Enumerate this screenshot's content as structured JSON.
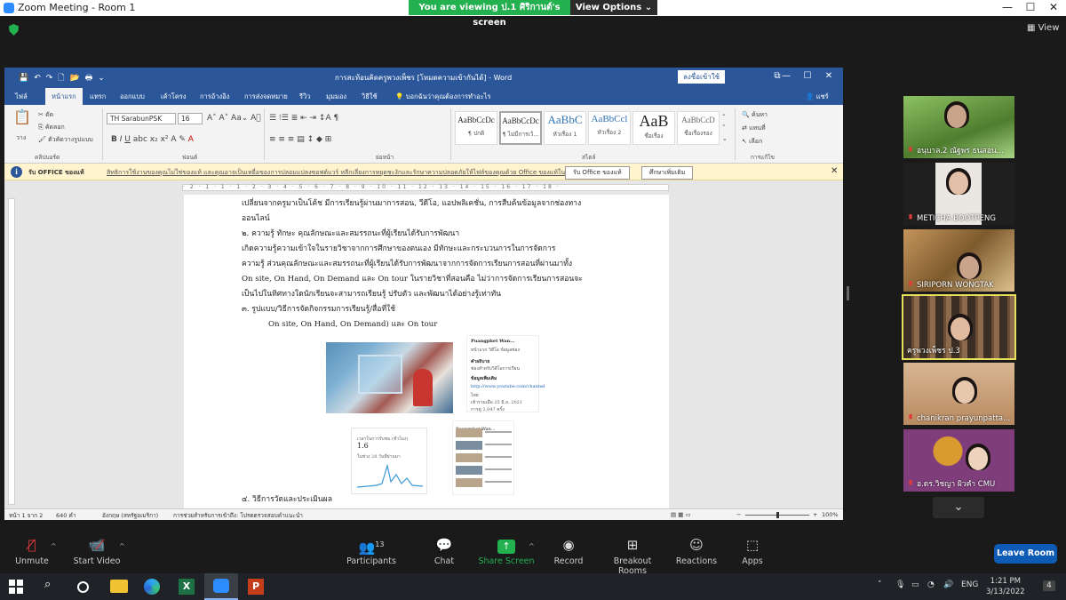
{
  "window": {
    "title": "Zoom Meeting - Room 1",
    "banner_text": "You are viewing ป.1 ศิริกานต์'s screen",
    "view_options": "View Options ⌄",
    "view_button": "View",
    "winctl": {
      "min": "—",
      "max": "☐",
      "close": "✕"
    }
  },
  "word": {
    "doc_title": "การสะท้อนคิดครูพวงเพ็ชร [โหมดความเข้ากันได้]  -  Word",
    "signin": "ลงชื่อเข้าใช้",
    "quick_access": "💾↶↷🗋📂🖶⌄",
    "winctl": {
      "restore": "⧉",
      "min": "—",
      "max": "☐",
      "close": "✕"
    },
    "tabs": [
      "ไฟล์",
      "หน้าแรก",
      "แทรก",
      "ออกแบบ",
      "เค้าโครง",
      "การอ้างอิง",
      "การส่งจดหมาย",
      "รีวิว",
      "มุมมอง",
      "วิธีใช้",
      "บอกฉันว่าคุณต้องการทำอะไร"
    ],
    "share": "แชร์",
    "ribbon": {
      "paste": "วาง",
      "cut": "ตัด",
      "copy": "คัดลอก",
      "format_painter": "ตัวคัดวางรูปแบบ",
      "font_name": "TH SarabunPSK",
      "font_size": "16",
      "find": "ค้นหา",
      "replace": "แทนที่",
      "select": "เลือก",
      "groups": [
        "คลิปบอร์ด",
        "ฟอนต์",
        "ย่อหน้า",
        "สไตล์",
        "การแก้ไข"
      ],
      "styles": [
        {
          "sample": "AaBbCcDc",
          "name": "¶ ปกติ"
        },
        {
          "sample": "AaBbCcDc",
          "name": "¶ ไม่มีการเว้..."
        },
        {
          "sample": "AaBbC",
          "name": "หัวเรื่อง 1"
        },
        {
          "sample": "AaBbCcl",
          "name": "หัวเรื่อง 2"
        },
        {
          "sample": "AaB",
          "name": "ชื่อเรื่อง"
        },
        {
          "sample": "AaBbCcD",
          "name": "ชื่อเรื่องรอง"
        }
      ]
    },
    "info_bar": {
      "label": "รับ OFFICE ของแท้",
      "message": "สิทธิการใช้งานของคุณไม่ใช่ของแท้ และคุณอาจเป็นเหยื่อของการปลอมแปลงซอฟต์แวร์ หลีกเลี่ยงการหยุดชะงักและรักษาความปลอดภัยให้ไฟล์ของคุณด้วย Office ของแท้ในวันนี้",
      "btn1": "รับ Office ของแท้",
      "btn2": "ศึกษาเพิ่มเติม",
      "close": "✕"
    },
    "ruler_text": "· 2 · 1 · 1 · 1 · 2 · 3 · 4 · 5 · 6 · 7 · 8 · 9 · 10 · 11 · 12 · 13 · 14 · 15 · 16 · 17 · 18 ·",
    "doc_lines": [
      "เปลี่ยนจากครูมาเป็นโค้ช   มีการเรียนรู้ผ่านมาการสอน,  วีดีโอ,  แอปพลิเคชั่น, การสืบค้นข้อมูลจากช่องทาง",
      "ออนไลน์",
      "๒. ความรู้ ทักษะ คุณลักษณะและสมรรถนะที่ผู้เรียนได้รับการพัฒนา",
      "          เกิดความรู้ความเข้าใจในรายวิชาจากการศึกษาของตนเอง มีทักษะและกระบวนการในการจัดการ",
      "ความรู้ ส่วนคุณลักษณะและสมรรถนะที่ผู้เรียนได้รับการพัฒนาจากการจัดการเรียนการสอนที่ผ่านมาทั้ง",
      "On site, On Hand, On Demand และ On tour ในรายวิชาที่สอนคือ ไม่ว่าการจัดการเรียนการสอนจะ",
      "เป็นไปในทิศทางใดนักเรียนจะสามารถเรียนรู้ ปรับตัว และพัฒนาได้อย่างรู้เท่าทัน",
      "๓. รูปแบบ/วิธีการจัดกิจกรรมการเรียนรู้/สื่อที่ใช้"
    ],
    "doc_indent_line": "On site, On Hand, On Demand) และ On tour",
    "doc_last_line": "๔.  วิธีการวัดและประเมินผล",
    "channel_card": {
      "name": "Puangphet Wan...",
      "tabs": "หน้าแรก   วิดีโอ   ข้อมูลช่อง",
      "about": "คำอธิบาย",
      "desc": "ช่องสำหรับวิดีโอการเรียน",
      "details": "ข้อมูลเพิ่มเติม",
      "link": "http://www.youtube.com/channel",
      "country": "ไทย",
      "joined": "เข้าร่วมเมื่อ 25 มิ.ย. 2021",
      "views": "การดู 2,047 ครั้ง"
    },
    "analytics": {
      "label": "เวลาในการรับชม (ชั่วโมง)",
      "value": "1.6",
      "sub": "ในช่วง 28 วันที่ผ่านมา"
    },
    "status_bar": {
      "page": "หน้า 1 จาก 2",
      "words": "640 คำ",
      "lang": "อังกฤษ (สหรัฐอเมริกา)",
      "accessibility": "การช่วยสำหรับการเข้าถึง: โปรดตรวจสอบคำแนะนำ",
      "zoom": "100%"
    },
    "zoom_fraction": 0.48
  },
  "participants": [
    {
      "name": "อนุบาล.2 ณัฐพร ธนสอน...",
      "bg": "#6e9c46"
    },
    {
      "name": "METICHA BOOTPENG",
      "bg": "#1f1f1f"
    },
    {
      "name": "SIRIPORN WONGTAK",
      "bg": "#8a6d47"
    },
    {
      "name": "ครูพวงเพ็ชร ป.3",
      "bg": "#5a4a3c",
      "active": true
    },
    {
      "name": "chanikran prayunpatta...",
      "bg": "#c79a72"
    },
    {
      "name": "อ.ดร.วิชญา ผิวคำ CMU",
      "bg": "#7f3e7b"
    }
  ],
  "controls": {
    "mute": "Unmute",
    "video": "Start Video",
    "participants": "Participants",
    "participants_count": "13",
    "chat": "Chat",
    "share": "Share Screen",
    "record": "Record",
    "breakout": "Breakout Rooms",
    "reactions": "Reactions",
    "apps": "Apps",
    "leave": "Leave Room"
  },
  "taskbar": {
    "lang": "ENG",
    "time": "1:21 PM",
    "date": "3/13/2022",
    "notifications": "4"
  },
  "colors": {
    "word_blue": "#2b579a",
    "zoom_green": "#23b04f",
    "leave_blue": "#0e5bb5",
    "active_speaker": "#e6e05a"
  }
}
